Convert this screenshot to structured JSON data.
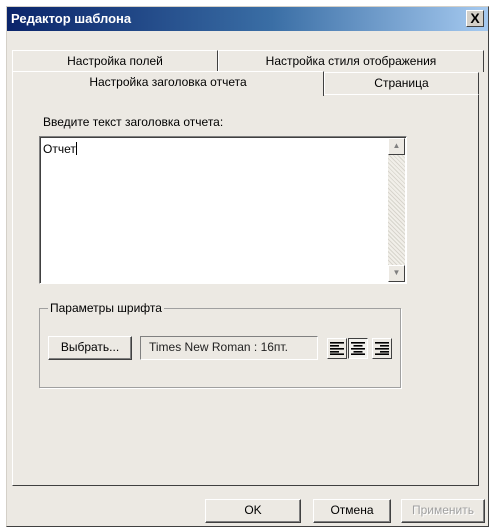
{
  "window": {
    "title": "Редактор шаблона",
    "close_label": "X"
  },
  "tabs": {
    "row_back": [
      {
        "label": "Настройка полей"
      },
      {
        "label": "Настройка стиля отображения"
      }
    ],
    "row_front": [
      {
        "label": "Настройка заголовка отчета",
        "active": true
      },
      {
        "label": "Страница"
      }
    ]
  },
  "header_tab": {
    "prompt": "Введите текст заголовка отчета:",
    "text_value": "Отчет"
  },
  "font_group": {
    "title": "Параметры шрифта",
    "choose_label": "Выбрать...",
    "font_value": "Times New Roman : 16пт.",
    "alignment_options": [
      "left",
      "center",
      "right"
    ],
    "alignment_selected": "center"
  },
  "footer": {
    "ok_label": "OK",
    "cancel_label": "Отмена",
    "apply_label": "Применить"
  }
}
